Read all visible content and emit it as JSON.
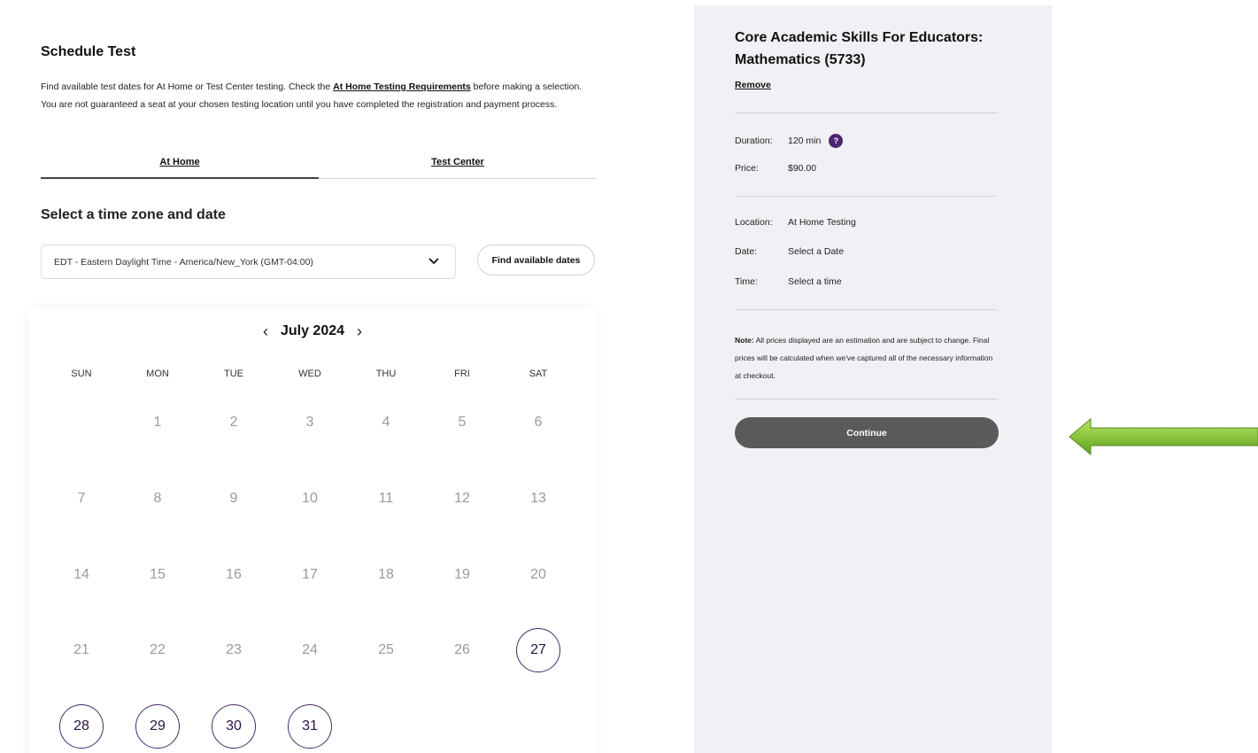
{
  "schedule": {
    "title": "Schedule Test",
    "intro_before": "Find available test dates for At Home or Test Center testing. Check the ",
    "intro_link": "At Home Testing Requirements",
    "intro_after": " before making a selection. You are not guaranteed a seat at your chosen testing location until you have completed the registration and payment process."
  },
  "tabs": [
    {
      "label": "At Home",
      "active": true
    },
    {
      "label": "Test Center",
      "active": false
    }
  ],
  "tz_section": {
    "title": "Select a time zone and date",
    "selected_tz": "EDT - Eastern Daylight Time - America/New_York (GMT-04:00)",
    "find_button": "Find available dates"
  },
  "calendar": {
    "prev": "‹",
    "next": "›",
    "month": "July 2024",
    "days_of_week": [
      "SUN",
      "MON",
      "TUE",
      "WED",
      "THU",
      "FRI",
      "SAT"
    ],
    "first_weekday": 1,
    "num_days": 31,
    "available_days": [
      27,
      28,
      29,
      30,
      31
    ]
  },
  "summary": {
    "title": "Core Academic Skills For Educators: Mathematics (5733)",
    "remove": "Remove",
    "duration_label": "Duration:",
    "duration_value": "120 min",
    "help": "?",
    "price_label": "Price:",
    "price_value": "$90.00",
    "location_label": "Location:",
    "location_value": "At Home Testing",
    "date_label": "Date:",
    "date_value": "Select a Date",
    "time_label": "Time:",
    "time_value": "Select a time",
    "note_bold": "Note:",
    "note_text": " All prices displayed are an estimation and are subject to change. Final prices will be calculated when we've captured all of the necessary information at checkout.",
    "continue": "Continue"
  },
  "colors": {
    "accent_purple": "#4b2670",
    "panel_bg": "#f1f0f4",
    "continue_bg": "#5a5a5a",
    "arrow_green": "#8cc63f"
  }
}
